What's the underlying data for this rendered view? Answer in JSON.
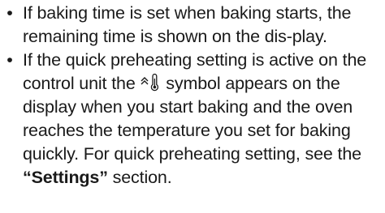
{
  "bullet_marker": "•",
  "items": [
    {
      "text": "If baking time is set when baking starts, the remaining time is shown on the dis-play."
    },
    {
      "text_before_symbol": "If the quick preheating setting is active on the control unit the ",
      "symbol_icon": "quick-preheat-thermometer-icon",
      "text_after_symbol": " symbol appears on the display when you start baking and the oven reaches the temperature you set for baking quickly. For quick preheating setting, see the ",
      "section_name": "“Settings”",
      "text_end": " section."
    }
  ]
}
